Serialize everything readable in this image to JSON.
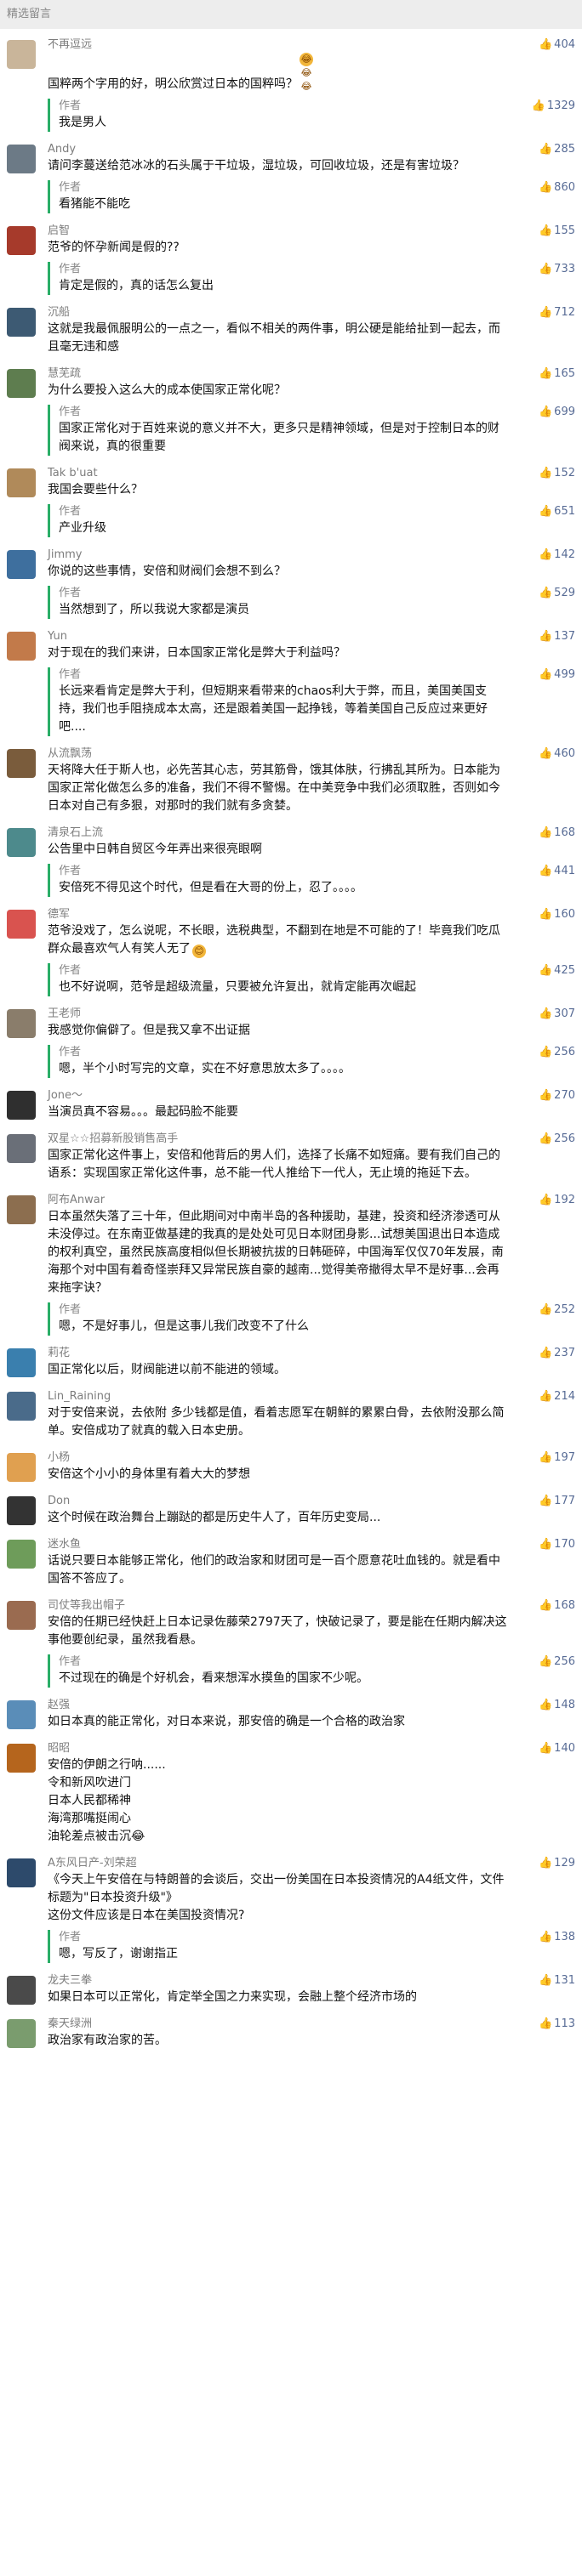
{
  "header": {
    "title": "精选留言"
  },
  "reply_label": "作者",
  "comments": [
    {
      "name": "不再逗远",
      "likes": "404",
      "text": "国粹两个字用的好，明公欣赏过日本的国粹吗？",
      "emoji": "😂😂😂",
      "reply": {
        "text": "我是男人",
        "likes": "1329"
      },
      "avatar": "#c9b59a"
    },
    {
      "name": "Andy",
      "likes": "285",
      "text": "请问李蔓送给范冰冰的石头属于干垃圾，湿垃圾，可回收垃圾，还是有害垃圾？",
      "reply": {
        "text": "看猪能不能吃",
        "likes": "860"
      },
      "avatar": "#6c7a86"
    },
    {
      "name": "启智",
      "likes": "155",
      "text": "范爷的怀孕新闻是假的??",
      "reply": {
        "text": "肯定是假的，真的话怎么复出",
        "likes": "733"
      },
      "avatar": "#a63a2b"
    },
    {
      "name": "沉船",
      "likes": "712",
      "text": "这就是我最佩服明公的一点之一，看似不相关的两件事，明公硬是能给扯到一起去，而且毫无违和感",
      "avatar": "#3d5a73"
    },
    {
      "name": "慧芜疏",
      "likes": "165",
      "text": "为什么要投入这么大的成本使国家正常化呢？",
      "reply": {
        "text": "国家正常化对于百姓来说的意义并不大，更多只是精神领域，但是对于控制日本的财阀来说，真的很重要",
        "likes": "699"
      },
      "avatar": "#5e7d4f"
    },
    {
      "name": "Tak b'uat",
      "likes": "152",
      "text": "我国会要些什么？",
      "reply": {
        "text": "产业升级",
        "likes": "651"
      },
      "avatar": "#b08a5a"
    },
    {
      "name": "Jimmy",
      "likes": "142",
      "text": "你说的这些事情，安倍和财阀们会想不到么？",
      "reply": {
        "text": "当然想到了，所以我说大家都是演员",
        "likes": "529"
      },
      "avatar": "#3e6f9e"
    },
    {
      "name": "Yun",
      "likes": "137",
      "text": "对于现在的我们来讲，日本国家正常化是弊大于利益吗？",
      "reply": {
        "text": "长远来看肯定是弊大于利，但短期来看带来的chaos利大于弊，而且，美国美国支持，我们也手阻挠成本太高，还是跟着美国一起挣钱，等着美国自己反应过来更好吧....",
        "likes": "499"
      },
      "avatar": "#c27a4a"
    },
    {
      "name": "从流飘荡",
      "likes": "460",
      "text": "天将降大任于斯人也，必先苦其心志，劳其筋骨，饿其体肤，行拂乱其所为。日本能为国家正常化做怎么多的准备，我们不得不警惕。在中美竞争中我们必须取胜，否则如今日本对自己有多狠，对那时的我们就有多贪婪。",
      "avatar": "#7a5c3c"
    },
    {
      "name": "清泉石上流",
      "likes": "168",
      "text": "公告里中日韩自贸区今年弄出来很亮眼啊",
      "reply": {
        "text": "安倍死不得见这个时代，但是看在大哥的份上，忍了。。。。",
        "likes": "441"
      },
      "avatar": "#4d8a8c"
    },
    {
      "name": "德军",
      "likes": "160",
      "text": "范爷没戏了，怎么说呢，不长眼，选税典型，不翻到在地是不可能的了！毕竟我们吃瓜群众最喜欢气人有笑人无了",
      "emoji": "😊",
      "reply": {
        "text": "也不好说啊，范爷是超级流量，只要被允许复出，就肯定能再次崛起",
        "likes": "425"
      },
      "avatar": "#d9534f"
    },
    {
      "name": "王老师",
      "likes": "307",
      "text": "我感觉你偏僻了。但是我又拿不出证据",
      "reply": {
        "text": "嗯，半个小时写完的文章，实在不好意思放太多了。。。。",
        "likes": "256"
      },
      "avatar": "#8a7d6b"
    },
    {
      "name": "Jone～",
      "likes": "270",
      "text": "当演员真不容易。。。最起码脸不能要",
      "avatar": "#2f2f2f"
    },
    {
      "name": "双星☆☆招募新股销售高手",
      "likes": "256",
      "text": "国家正常化这件事上，安倍和他背后的男人们，选择了长痛不如短痛。要有我们自己的语系：实现国家正常化这件事，总不能一代人推给下一代人，无止境的拖延下去。",
      "avatar": "#6a6f78"
    },
    {
      "name": "阿布Anwar",
      "likes": "192",
      "text": "日本虽然失落了三十年，但此期间对中南半岛的各种援助，基建，投资和经济渗透可从未没停过。在东南亚做基建的我真的是处处可见日本财团身影...试想美国退出日本造成的权利真空，虽然民族高度相似但长期被抗拔的日韩砸碎，中国海军仅仅70年发展，南海那个对中国有着奇怪崇拜又异常民族自豪的越南...觉得美帝撤得太早不是好事...会再来拖字诀？",
      "reply": {
        "text": "嗯，不是好事儿，但是这事儿我们改变不了什么",
        "likes": "252"
      },
      "avatar": "#8c6e4f"
    },
    {
      "name": "莉花",
      "likes": "237",
      "text": "国正常化以后，财阀能进以前不能进的领域。",
      "avatar": "#3a7fae"
    },
    {
      "name": "Lin_Raining",
      "likes": "214",
      "text": "对于安倍来说，去依附 多少钱都是值，看着志愿军在朝鲜的累累白骨，去依附没那么简单。安倍成功了就真的载入日本史册。",
      "avatar": "#4a6b8a"
    },
    {
      "name": "小杨",
      "likes": "197",
      "text": "安倍这个小小的身体里有着大大的梦想",
      "avatar": "#e0a050"
    },
    {
      "name": "Don",
      "likes": "177",
      "text": "这个时候在政治舞台上蹦跶的都是历史牛人了，百年历史变局...",
      "avatar": "#333333"
    },
    {
      "name": "迷水鱼",
      "likes": "170",
      "text": "话说只要日本能够正常化，他们的政治家和财团可是一百个愿意花吐血钱的。就是看中国答不答应了。",
      "avatar": "#6e9c5a"
    },
    {
      "name": "司仗等我出帽子",
      "likes": "168",
      "text": "安倍的任期已经快赶上日本记录佐藤荣2797天了，快破记录了，要是能在任期内解决这事他要创纪录，虽然我看悬。",
      "reply": {
        "text": "不过现在的确是个好机会，看来想浑水摸鱼的国家不少呢。",
        "likes": "256"
      },
      "avatar": "#9a6b50"
    },
    {
      "name": "赵强",
      "likes": "148",
      "text": "如日本真的能正常化，对日本来说，那安倍的确是一个合格的政治家",
      "avatar": "#5a8db8"
    },
    {
      "name": "昭昭",
      "likes": "140",
      "text": "安倍的伊朗之行呐......\n令和新风吹进门\n日本人民都稀神\n海湾那嘴挺闹心\n油轮差点被击沉😂",
      "avatar": "#b5651d"
    },
    {
      "name": "A东风日产-刘荣超",
      "likes": "129",
      "text": "《今天上午安倍在与特朗普的会谈后，交出一份美国在日本投资情况的A4纸文件，文件标题为\"日本投资升级\"》\n这份文件应该是日本在美国投资情况?",
      "reply": {
        "text": "嗯，写反了，谢谢指正",
        "likes": "138"
      },
      "avatar": "#2d4a6b"
    },
    {
      "name": "龙夫三拳",
      "likes": "131",
      "text": "如果日本可以正常化，肯定举全国之力来实现，会融上整个经济市场的",
      "avatar": "#4a4a4a"
    },
    {
      "name": "秦天绿洲",
      "likes": "113",
      "text": "政治家有政治家的苦。",
      "avatar": "#7a9c6e"
    }
  ]
}
